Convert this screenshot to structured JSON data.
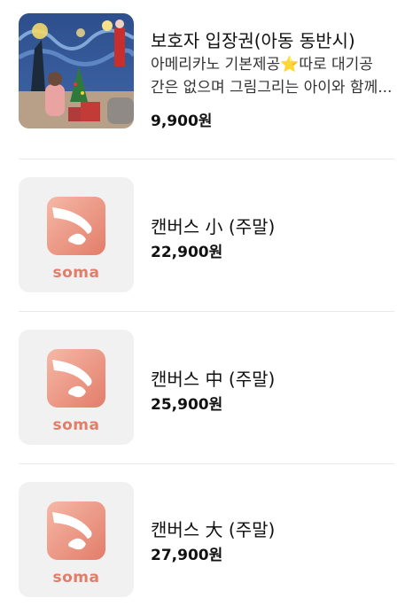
{
  "items": [
    {
      "title": "보호자 입장권(아동 동반시)",
      "desc_line1": "아메리카노 기본제공⭐따로 대기공",
      "desc_line2": "간은 없으며 그림그리는 아이와 함께...",
      "price": "9,900원",
      "thumb": "starry-night-photo"
    },
    {
      "title": "캔버스 小 (주말)",
      "price": "22,900원",
      "thumb": "soma-logo",
      "logo_text": "soma"
    },
    {
      "title": "캔버스 中 (주말)",
      "price": "25,900원",
      "thumb": "soma-logo",
      "logo_text": "soma"
    },
    {
      "title": "캔버스 大 (주말)",
      "price": "27,900원",
      "thumb": "soma-logo",
      "logo_text": "soma"
    }
  ],
  "colors": {
    "brand": "#e27d6a",
    "brand_light": "#f3b29e",
    "thumb_bg": "#f1f1f1",
    "divider": "#e9e9e9"
  }
}
